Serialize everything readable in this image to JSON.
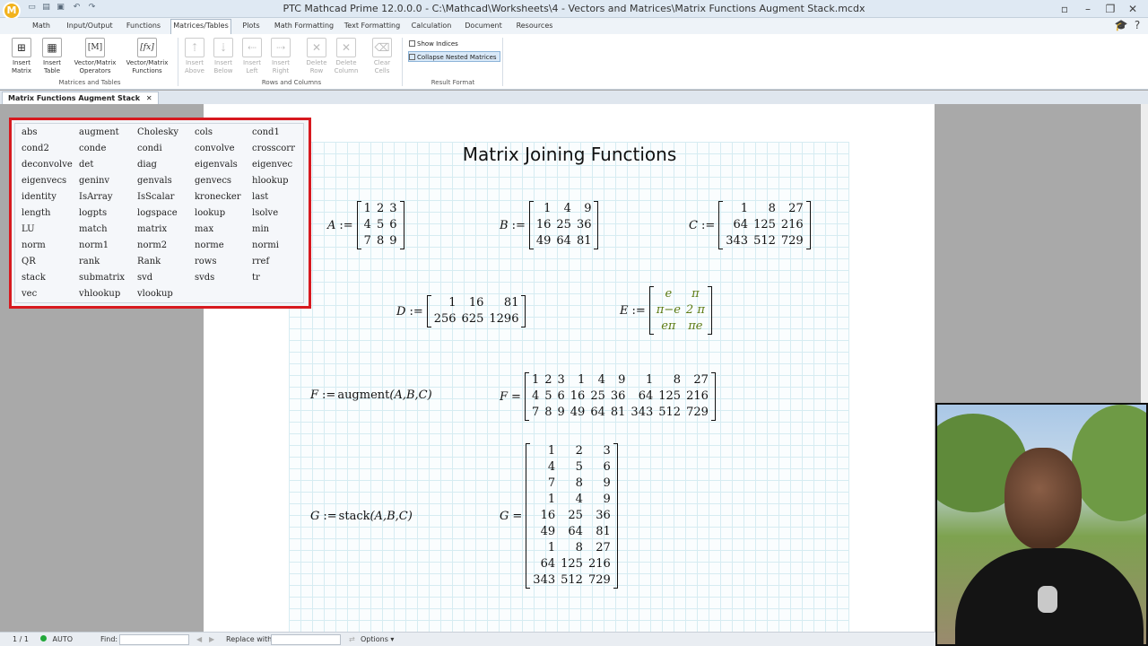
{
  "window": {
    "title": "PTC Mathcad Prime 12.0.0.0 - C:\\Mathcad\\Worksheets\\4 - Vectors and Matrices\\Matrix Functions Augment Stack.mcdx",
    "app_icon_letter": "M"
  },
  "ribbon_tabs": [
    "Math",
    "Input/Output",
    "Functions",
    "Matrices/Tables",
    "Plots",
    "Math Formatting",
    "Text Formatting",
    "Calculation",
    "Document",
    "Resources"
  ],
  "active_tab": "Matrices/Tables",
  "ribbon": {
    "insert_matrix": "Insert\nMatrix",
    "insert_table": "Insert\nTable",
    "vm_operators": "Vector/Matrix\nOperators",
    "vm_functions": "Vector/Matrix\nFunctions",
    "group_matrices": "Matrices and Tables",
    "insert_above": "Insert\nAbove",
    "insert_below": "Insert\nBelow",
    "insert_left": "Insert\nLeft",
    "insert_right": "Insert\nRight",
    "delete_row": "Delete\nRow",
    "delete_column": "Delete\nColumn",
    "clear_cells": "Clear\nCells",
    "group_rows": "Rows and Columns",
    "show_indices": "Show Indices",
    "collapse_nested": "Collapse Nested Matrices",
    "group_result": "Result Format",
    "operators_glyph": "[M]",
    "functions_glyph": "[fx]"
  },
  "document_tab": "Matrix Functions Augment Stack",
  "worksheet": {
    "heading": "Matrix Joining Functions",
    "A": {
      "name": "A",
      "rows": [
        [
          "1",
          "2",
          "3"
        ],
        [
          "4",
          "5",
          "6"
        ],
        [
          "7",
          "8",
          "9"
        ]
      ]
    },
    "B": {
      "name": "B",
      "rows": [
        [
          "1",
          "4",
          "9"
        ],
        [
          "16",
          "25",
          "36"
        ],
        [
          "49",
          "64",
          "81"
        ]
      ]
    },
    "C": {
      "name": "C",
      "rows": [
        [
          "1",
          "8",
          "27"
        ],
        [
          "64",
          "125",
          "216"
        ],
        [
          "343",
          "512",
          "729"
        ]
      ]
    },
    "D": {
      "name": "D",
      "rows": [
        [
          "1",
          "16",
          "81"
        ],
        [
          "256",
          "625",
          "1296"
        ]
      ]
    },
    "E": {
      "name": "E",
      "rows": [
        [
          "e",
          "π"
        ],
        [
          "π−e",
          "2 π"
        ],
        [
          "eπ",
          "πe"
        ]
      ]
    },
    "F_def": {
      "name": "F",
      "expr": "augment",
      "args": "(A,B,C)"
    },
    "F_res": {
      "name": "F",
      "rows": [
        [
          "1",
          "2",
          "3",
          "1",
          "4",
          "9",
          "1",
          "8",
          "27"
        ],
        [
          "4",
          "5",
          "6",
          "16",
          "25",
          "36",
          "64",
          "125",
          "216"
        ],
        [
          "7",
          "8",
          "9",
          "49",
          "64",
          "81",
          "343",
          "512",
          "729"
        ]
      ]
    },
    "G_def": {
      "name": "G",
      "expr": "stack",
      "args": "(A,B,C)"
    },
    "G_res": {
      "name": "G",
      "rows": [
        [
          "1",
          "2",
          "3"
        ],
        [
          "4",
          "5",
          "6"
        ],
        [
          "7",
          "8",
          "9"
        ],
        [
          "1",
          "4",
          "9"
        ],
        [
          "16",
          "25",
          "36"
        ],
        [
          "49",
          "64",
          "81"
        ],
        [
          "1",
          "8",
          "27"
        ],
        [
          "64",
          "125",
          "216"
        ],
        [
          "343",
          "512",
          "729"
        ]
      ]
    }
  },
  "function_list": [
    "abs",
    "augment",
    "Cholesky",
    "cols",
    "cond1",
    "cond2",
    "conde",
    "condi",
    "convolve",
    "crosscorr",
    "deconvolve",
    "det",
    "diag",
    "eigenvals",
    "eigenvec",
    "eigenvecs",
    "geninv",
    "genvals",
    "genvecs",
    "hlookup",
    "identity",
    "IsArray",
    "IsScalar",
    "kronecker",
    "last",
    "length",
    "logpts",
    "logspace",
    "lookup",
    "lsolve",
    "LU",
    "match",
    "matrix",
    "max",
    "min",
    "norm",
    "norm1",
    "norm2",
    "norme",
    "normi",
    "QR",
    "rank",
    "Rank",
    "rows",
    "rref",
    "stack",
    "submatrix",
    "svd",
    "svds",
    "tr",
    "vec",
    "vhlookup",
    "vlookup"
  ],
  "status": {
    "page": "1 / 1",
    "calc_mode": "AUTO",
    "find_label": "Find:",
    "replace_label": "Replace with:",
    "options_label": "Options"
  },
  "colors": {
    "highlight_border": "#d7191f",
    "symbolic_green": "#5c7a12"
  }
}
